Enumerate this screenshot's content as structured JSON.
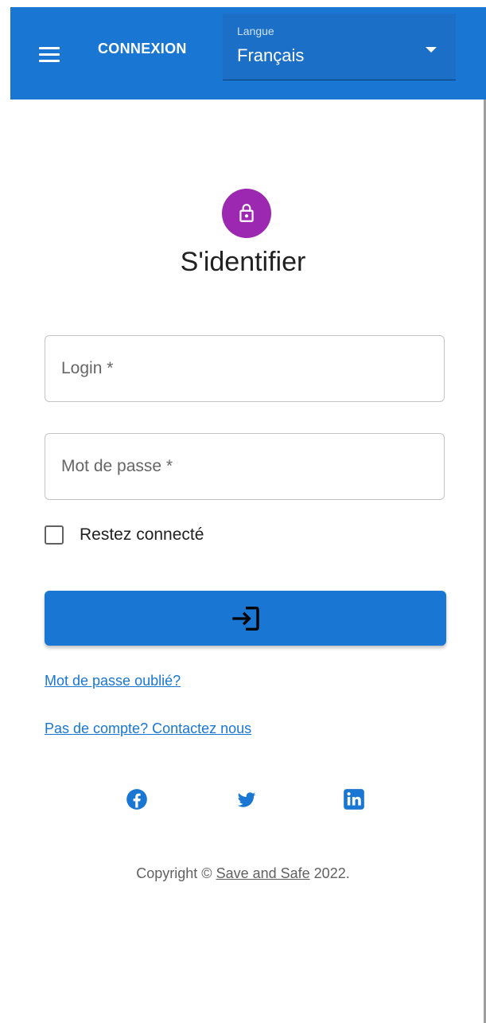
{
  "header": {
    "title": "CONNEXION",
    "language_label": "Langue",
    "language_value": "Français"
  },
  "form": {
    "heading": "S'identifier",
    "login_placeholder": "Login *",
    "password_placeholder": "Mot de passe *",
    "remember_label": "Restez connecté",
    "remember_checked": false
  },
  "links": {
    "forgot": "Mot de passe oublié?",
    "contact": "Pas de compte? Contactez nous"
  },
  "social": [
    "facebook-icon",
    "twitter-icon",
    "linkedin-icon"
  ],
  "footer": {
    "prefix": "Copyright © ",
    "brand": "Save and Safe",
    "suffix": " 2022."
  },
  "colors": {
    "primary": "#1976d2",
    "avatar": "#9c27b0"
  }
}
